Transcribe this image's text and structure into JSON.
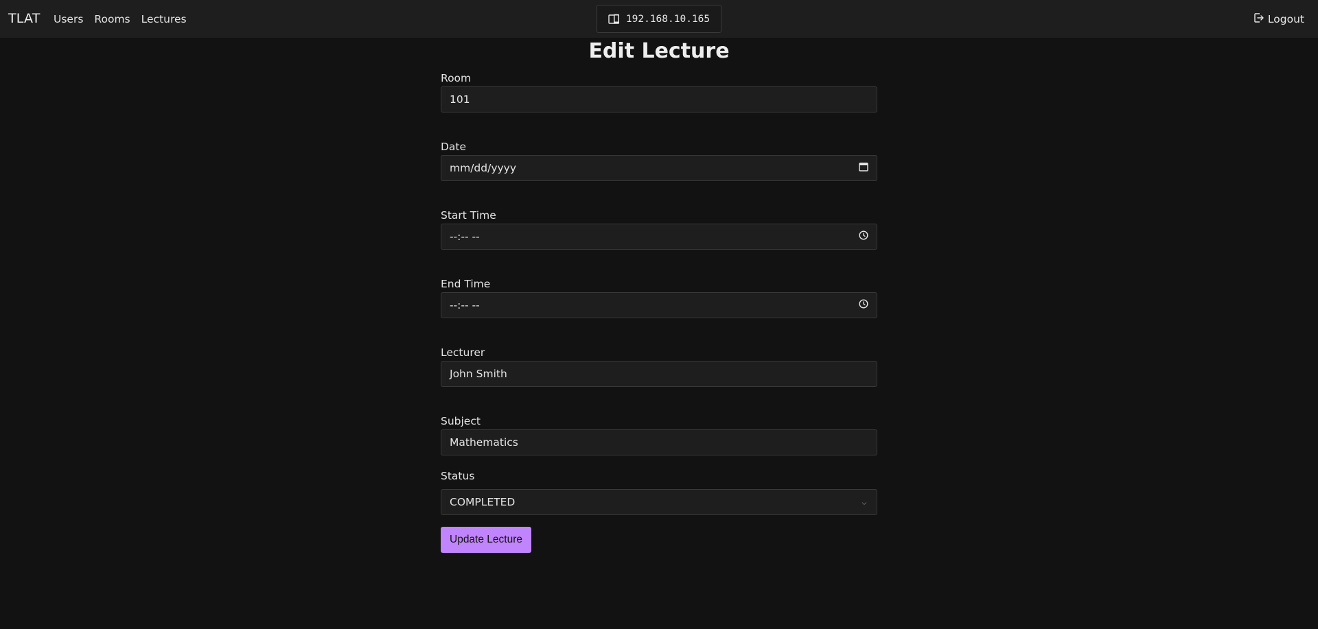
{
  "header": {
    "brand": "TLAT",
    "nav": [
      {
        "label": "Users"
      },
      {
        "label": "Rooms"
      },
      {
        "label": "Lectures"
      }
    ],
    "ip_address": "192.168.10.165",
    "ip_icon": "device-icon",
    "logout_label": "Logout",
    "logout_icon": "logout-icon"
  },
  "page": {
    "title": "Edit Lecture"
  },
  "form": {
    "room": {
      "label": "Room",
      "value": "101"
    },
    "date": {
      "label": "Date",
      "placeholder": "mm/dd/yyyy",
      "icon": "calendar-icon"
    },
    "start_time": {
      "label": "Start Time",
      "placeholder": "--:-- --",
      "icon": "clock-icon"
    },
    "end_time": {
      "label": "End Time",
      "placeholder": "--:-- --",
      "icon": "clock-icon"
    },
    "lecturer": {
      "label": "Lecturer",
      "value": "John Smith"
    },
    "subject": {
      "label": "Subject",
      "value": "Mathematics"
    },
    "status": {
      "label": "Status",
      "value": "COMPLETED",
      "icon": "chevron-down-icon"
    },
    "submit_label": "Update Lecture"
  },
  "colors": {
    "background": "#121212",
    "topbar": "#1e1e1e",
    "input_bg": "#1e1e1e",
    "accent": "#c084fc"
  }
}
